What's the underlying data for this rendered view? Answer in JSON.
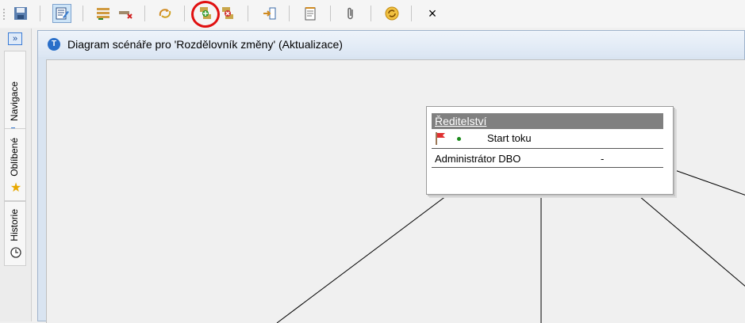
{
  "toolbar": {
    "buttons": [
      {
        "name": "save-icon"
      },
      {
        "name": "edit-properties-icon"
      },
      {
        "name": "add-rows-icon"
      },
      {
        "name": "delete-row-icon"
      },
      {
        "name": "refresh-arrows-icon"
      },
      {
        "name": "start-flow-icon"
      },
      {
        "name": "stop-flow-icon"
      },
      {
        "name": "insert-step-icon"
      },
      {
        "name": "notes-icon"
      },
      {
        "name": "attachment-icon"
      },
      {
        "name": "sync-icon"
      },
      {
        "name": "close-icon"
      }
    ],
    "close_label": "×"
  },
  "sidebar": {
    "expand_label": "»",
    "tabs": [
      {
        "label": "Navigace",
        "icon": "navigation-tree-icon"
      },
      {
        "label": "Oblíbené",
        "icon": "star-icon"
      },
      {
        "label": "Historie",
        "icon": "clock-icon"
      }
    ]
  },
  "panel": {
    "title": "Diagram scénáře pro 'Rozdělovník změny' (Aktualizace)",
    "icon": "diagram-icon"
  },
  "node": {
    "name": "Ředitelství",
    "state": "Start toku",
    "role": "Administrátor DBO",
    "role_value": "-"
  },
  "colors": {
    "highlight": "#e01010",
    "node_header": "#808080",
    "accent": "#2a6fc9"
  }
}
